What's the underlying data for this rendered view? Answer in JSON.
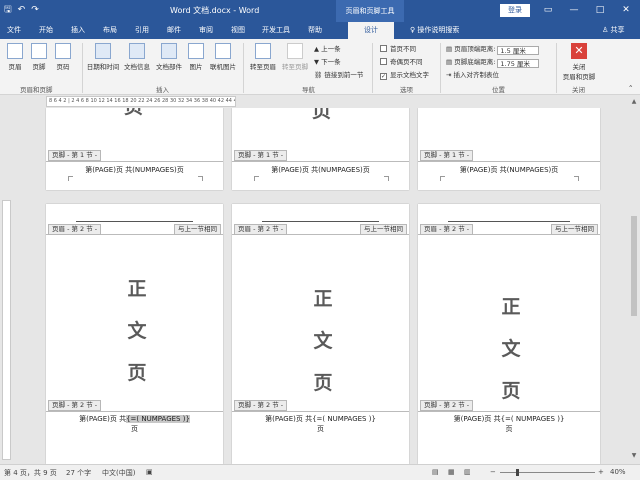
{
  "titlebar": {
    "save_icon": "save-icon",
    "undo_icon": "undo-icon",
    "redo_icon": "redo-icon",
    "title": "Word 文档.docx - Word",
    "context_tools": "页眉和页脚工具",
    "login": "登录",
    "restore": "▭",
    "minimize": "—",
    "maximize": "□",
    "close": "✕"
  },
  "tabs": {
    "items": [
      "文件",
      "开始",
      "插入",
      "布局",
      "引用",
      "邮件",
      "审阅",
      "视图",
      "开发工具",
      "帮助",
      "设计"
    ],
    "active": "设计",
    "search": "操作说明搜索",
    "share": "共享"
  },
  "ribbon": {
    "header_footer_group": {
      "header": "页眉",
      "footer": "页脚",
      "page_number": "页码",
      "label": "页眉和页脚"
    },
    "insert_group": {
      "datetime": "日期和时间",
      "docinfo": "文档信息",
      "docparts": "文档部件",
      "picture": "图片",
      "online_picture": "联机图片",
      "label": "插入"
    },
    "nav_group": {
      "goto_header": "转至页眉",
      "goto_footer": "转至页脚",
      "prev": "上一条",
      "next": "下一条",
      "link_prev": "链接到前一节",
      "label": "导航"
    },
    "options_group": {
      "first_page": "首页不同",
      "odd_even": "奇偶页不同",
      "show_text": "显示文档文字",
      "label": "选项"
    },
    "position_group": {
      "header_dist_label": "页眉顶端距离:",
      "header_dist_value": "1.5 厘米",
      "footer_dist_label": "页脚底端距离:",
      "footer_dist_value": "1.75 厘米",
      "insert_align": "插入对齐制表位",
      "label": "位置"
    },
    "close_group": {
      "close": "关闭",
      "close2": "页眉和页脚",
      "label": "关闭"
    }
  },
  "ruler": {
    "text": "8 6 4 2 | 2  4  6  8 10 12 14 16 18 20 22 24 26 28 30 32 34 36 38 40  42 44 46 48"
  },
  "pages_top": {
    "footer_tag": "页脚 - 第 1 节 -",
    "footer_text": "第(PAGE)页  共(NUMPAGES)页",
    "peek_char": "页"
  },
  "pages_main": {
    "header_tag": "页眉 - 第 2 节 -",
    "link_tag": "与上一节相同",
    "footer_tag": "页脚 - 第 2 节 -",
    "chars": [
      "正",
      "文",
      "页"
    ],
    "footer_line_prefix": "第(PAGE)页  共",
    "footer_field": "{=(  NUMPAGES  )}",
    "footer_line2": "页"
  },
  "statusbar": {
    "page_info": "第 4 页，共 9 页",
    "words": "27 个字",
    "language": "中文(中国)",
    "zoom_out": "−",
    "zoom_in": "+",
    "zoom": "40%",
    "zoom_level": 0.4
  }
}
